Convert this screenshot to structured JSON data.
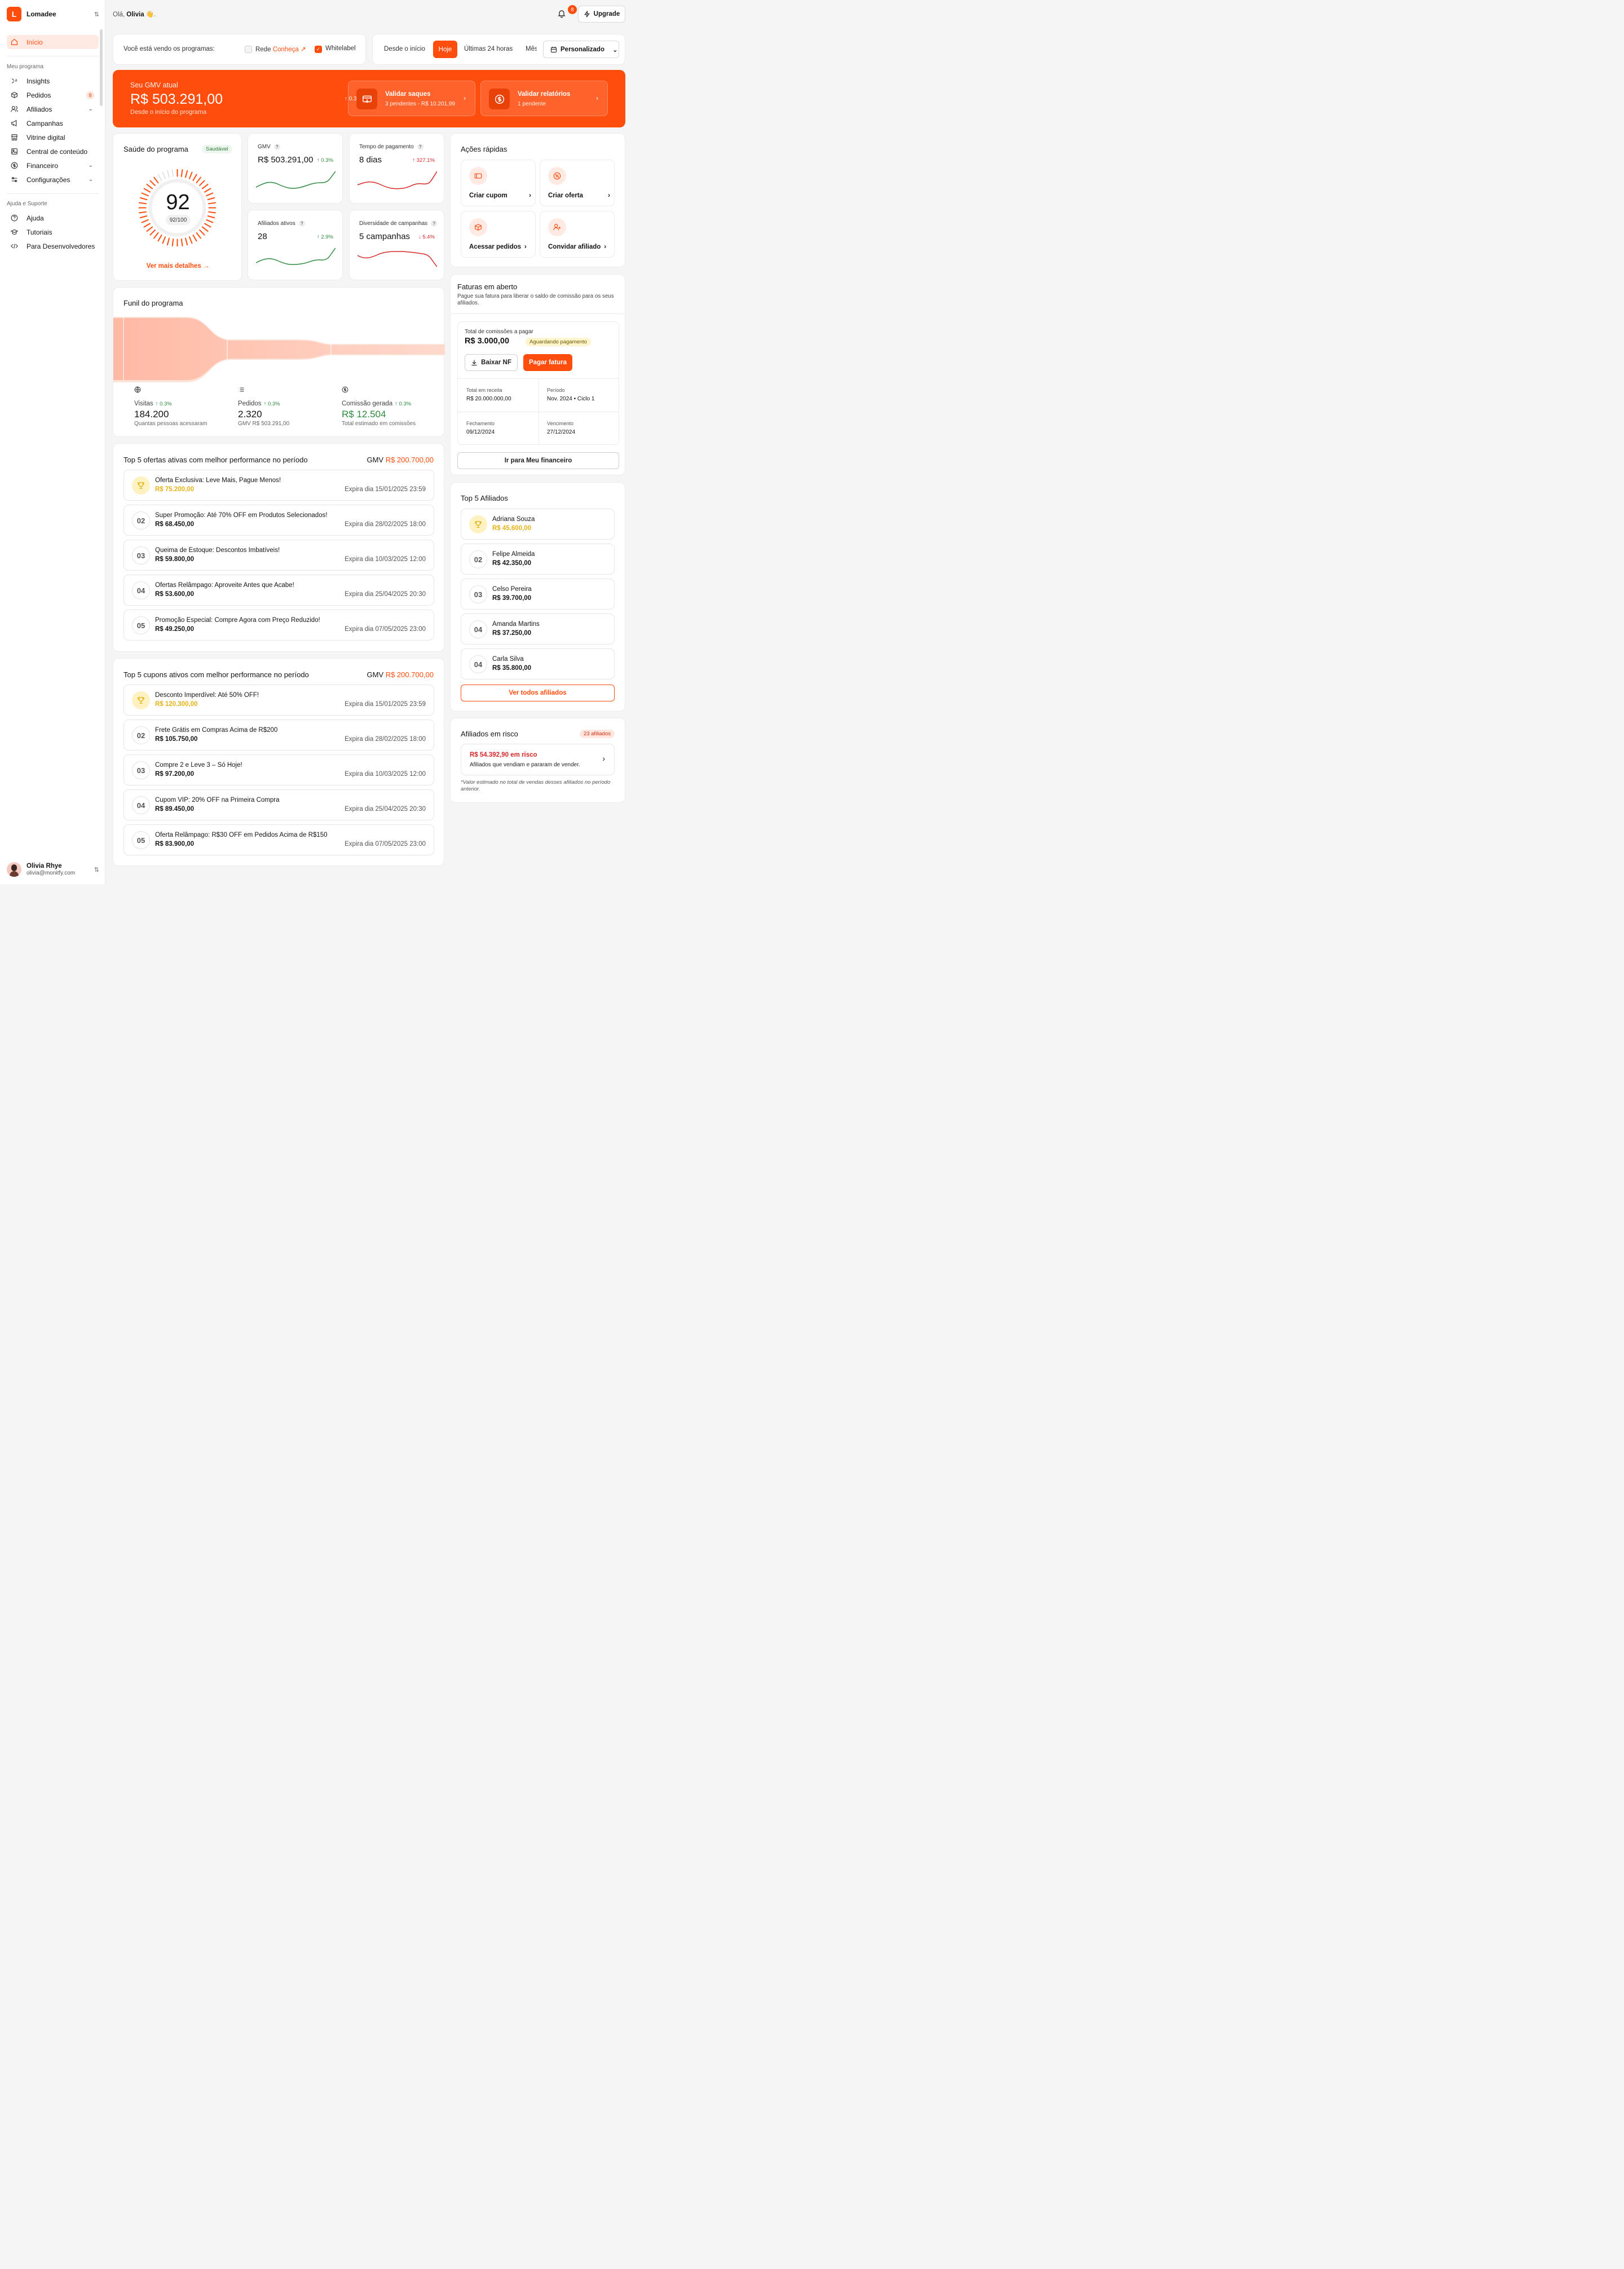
{
  "brand": {
    "name": "Lomadee",
    "logo_letter": "L"
  },
  "sidebar": {
    "home": "Início",
    "section_program": "Meu programa",
    "items": [
      {
        "label": "Insights",
        "icon": "sparkle-icon"
      },
      {
        "label": "Pedidos",
        "icon": "box-icon",
        "badge": "8"
      },
      {
        "label": "Afiliados",
        "icon": "users-icon",
        "chevron": true
      },
      {
        "label": "Campanhas",
        "icon": "megaphone-icon"
      },
      {
        "label": "Vitrine digital",
        "icon": "store-icon"
      },
      {
        "label": "Central de conteúdo",
        "icon": "image-icon"
      },
      {
        "label": "Financeiro",
        "icon": "dollar-icon",
        "chevron": true
      },
      {
        "label": "Configurações",
        "icon": "sliders-icon",
        "chevron": true
      }
    ],
    "section_help": "Ajuda e Suporte",
    "help_items": [
      {
        "label": "Ajuda",
        "icon": "help-icon"
      },
      {
        "label": "Tutoriais",
        "icon": "graduation-icon"
      },
      {
        "label": "Para Desenvolvedores",
        "icon": "code-icon"
      }
    ],
    "user": {
      "name": "Olivia Rhye",
      "email": "olivia@monitfy.com"
    }
  },
  "header": {
    "greeting_prefix": "Olá, ",
    "greeting_name": "Olivia",
    "greeting_suffix": " 👋.",
    "notifications": "8",
    "upgrade": "Upgrade"
  },
  "programs": {
    "label": "Você está vendo os programas:",
    "rede": "Rede",
    "rede_link": "Conheça",
    "whitelabel": "Whitelabel"
  },
  "period": {
    "since": "Desde o início",
    "today": "Hoje",
    "last24": "Últimas 24 horas",
    "month": "Mês",
    "custom": "Personalizado"
  },
  "hero": {
    "label": "Seu GMV atual",
    "value": "R$ 503.291,00",
    "pct": "0.3%",
    "sub": "Desde o início do programa",
    "btn1_title": "Validar saques",
    "btn1_sub": "3 pendentes - R$ 10.201,99",
    "btn2_title": "Validar relatórios",
    "btn2_sub": "1 pendente"
  },
  "health": {
    "title": "Saúde do programa",
    "badge": "Saudável",
    "score": "92",
    "score_sub": "92/100",
    "score_value": 92,
    "more": "Ver mais detalhes"
  },
  "stats": {
    "gmv": {
      "label": "GMV",
      "value": "R$ 503.291,00",
      "pct": "0.3%"
    },
    "payment": {
      "label": "Tempo de pagamento",
      "value": "8 dias",
      "pct": "327.1%"
    },
    "affiliates": {
      "label": "Afiliados ativos",
      "value": "28",
      "pct": "2.9%"
    },
    "campaigns": {
      "label": "Diversidade de campanhas",
      "value": "5 campanhas",
      "pct": "5.4%"
    },
    "colors": {
      "up": "#2f8a3f",
      "down": "#d62828"
    }
  },
  "quick": {
    "title": "Ações rápidas",
    "items": [
      {
        "label": "Criar cupom",
        "icon": "ticket-icon"
      },
      {
        "label": "Criar oferta",
        "icon": "percent-icon"
      },
      {
        "label": "Acessar pedidos",
        "icon": "package-icon"
      },
      {
        "label": "Convidar afiliado",
        "icon": "user-plus-icon"
      }
    ]
  },
  "funnel": {
    "title": "Funil do programa",
    "cols": [
      {
        "label": "Visitas",
        "pct": "0.3%",
        "value": "184.200",
        "sub": "Quantas pessoas acessaram",
        "icon": "globe-icon"
      },
      {
        "label": "Pedidos",
        "pct": "0.3%",
        "value": "2.320",
        "sub": "GMV R$ 503.291,00",
        "icon": "list-icon"
      },
      {
        "label": "Comissão gerada",
        "pct": "0.3%",
        "value": "R$ 12.504",
        "sub": "Total estimado em comissões",
        "icon": "dollar-icon"
      }
    ]
  },
  "invoice": {
    "title": "Faturas em aberto",
    "desc": "Pague sua fatura para liberar o saldo de comissão para os seus afiliados.",
    "total_label": "Total de comissões a pagar",
    "total": "R$ 3.000,00",
    "status": "Aguardando pagamento",
    "download": "Baixar NF",
    "pay": "Pagar fatura",
    "cells": [
      {
        "label": "Total em receita",
        "value": "R$ 20.000.000,00"
      },
      {
        "label": "Período",
        "value": "Nov. 2024 • Ciclo 1"
      },
      {
        "label": "Fechamento",
        "value": "09/12/2024"
      },
      {
        "label": "Vencimento",
        "value": "27/12/2024"
      }
    ],
    "go": "Ir para Meu financeiro"
  },
  "offers": {
    "title": "Top 5 ofertas ativas com melhor performance no período",
    "gmv_label": "GMV ",
    "gmv": "R$ 200.700,00",
    "rows": [
      {
        "rank": "",
        "title": "Oferta Exclusiva: Leve Mais, Pague Menos!",
        "value": "R$ 75.200,00",
        "exp": "Expira dia 15/01/2025 23:59"
      },
      {
        "rank": "02",
        "title": "Super Promoção: Até 70% OFF em Produtos Selecionados!",
        "value": "R$ 68.450,00",
        "exp": "Expira dia 28/02/2025 18:00"
      },
      {
        "rank": "03",
        "title": "Queima de Estoque: Descontos Imbatíveis!",
        "value": "R$ 59.800,00",
        "exp": "Expira dia 10/03/2025 12:00"
      },
      {
        "rank": "04",
        "title": "Ofertas Relâmpago: Aproveite Antes que Acabe!",
        "value": "R$ 53.600,00",
        "exp": "Expira dia 25/04/2025 20:30"
      },
      {
        "rank": "05",
        "title": "Promoção Especial: Compre Agora com Preço Reduzido!",
        "value": "R$ 49.250,00",
        "exp": "Expira dia 07/05/2025 23:00"
      }
    ]
  },
  "coupons": {
    "title": "Top 5 cupons ativos com melhor performance no período",
    "gmv_label": "GMV ",
    "gmv": "R$ 200.700,00",
    "rows": [
      {
        "rank": "",
        "title": "Desconto Imperdível: Até 50% OFF!",
        "value": "R$ 120.300,00",
        "exp": "Expira dia 15/01/2025 23:59"
      },
      {
        "rank": "02",
        "title": "Frete Grátis em Compras Acima de R$200",
        "value": "R$ 105.750,00",
        "exp": "Expira dia 28/02/2025 18:00"
      },
      {
        "rank": "03",
        "title": "Compre 2 e Leve 3 – Só Hoje!",
        "value": "R$ 97.200,00",
        "exp": "Expira dia 10/03/2025 12:00"
      },
      {
        "rank": "04",
        "title": "Cupom VIP: 20% OFF na Primeira Compra",
        "value": "R$ 89.450,00",
        "exp": "Expira dia 25/04/2025 20:30"
      },
      {
        "rank": "05",
        "title": "Oferta Relâmpago: R$30 OFF em Pedidos Acima de R$150",
        "value": "R$ 83.900,00",
        "exp": "Expira dia 07/05/2025 23:00"
      }
    ]
  },
  "affiliates": {
    "title": "Top 5 Afiliados",
    "rows": [
      {
        "rank": "",
        "name": "Adriana Souza",
        "value": "R$ 45.600,00"
      },
      {
        "rank": "02",
        "name": "Felipe Almeida",
        "value": "R$ 42.350,00"
      },
      {
        "rank": "03",
        "name": "Celso Pereira",
        "value": "R$ 39.700,00"
      },
      {
        "rank": "04",
        "name": "Amanda Martins",
        "value": "R$ 37.250,00"
      },
      {
        "rank": "04",
        "name": "Carla Silva",
        "value": "R$ 35.800,00"
      }
    ],
    "all": "Ver todos afiliados"
  },
  "risk": {
    "title": "Afiliados em risco",
    "badge": "23 afiliados",
    "amount": "R$ 54.392,90 em risco",
    "desc": "Afiliados que vendiam e pararam de vender.",
    "note": "*Valor estimado no total de vendas desses afiliados no período anterior."
  },
  "theme": {
    "accent": "#ff4d0d",
    "gold": "#e6b317"
  }
}
